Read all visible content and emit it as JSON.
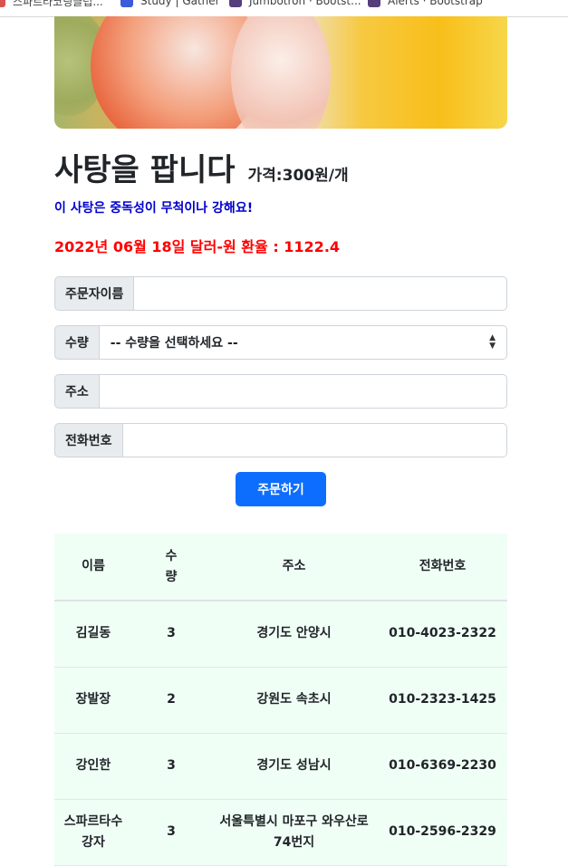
{
  "bookmarks": [
    {
      "label": "스파르타코딩클럽..."
    },
    {
      "label": "Study | Gather"
    },
    {
      "label": "Jumbotron · Bootst..."
    },
    {
      "label": "Alerts · Bootstrap"
    }
  ],
  "product": {
    "title": "사탕을 팝니다",
    "price": "가격:300원/개",
    "description": "이 사탕은 중독성이 무척이나 강해요!",
    "exchange_rate": "2022년 06월 18일 달러-원 환율 : 1122.4"
  },
  "form": {
    "name_label": "주문자이름",
    "name_value": "",
    "quantity_label": "수량",
    "quantity_selected": "-- 수량을 선택하세요 --",
    "address_label": "주소",
    "address_value": "",
    "phone_label": "전화번호",
    "phone_value": "",
    "submit_label": "주문하기"
  },
  "orders": {
    "headers": [
      "이름",
      "수량",
      "주소",
      "전화번호"
    ],
    "rows": [
      [
        "김길동",
        "3",
        "경기도 안양시",
        "010-4023-2322"
      ],
      [
        "장발장",
        "2",
        "강원도 속초시",
        "010-2323-1425"
      ],
      [
        "강인한",
        "3",
        "경기도 성남시",
        "010-6369-2230"
      ],
      [
        "스파르타수강자",
        "3",
        "서울특별시 마포구 와우산로 74번지",
        "010-2596-2329"
      ]
    ]
  },
  "colors": {
    "primary": "#0d6efd",
    "description_text": "#0000cc",
    "rate_text": "#ff0000",
    "table_bg": "#f0fff6"
  }
}
